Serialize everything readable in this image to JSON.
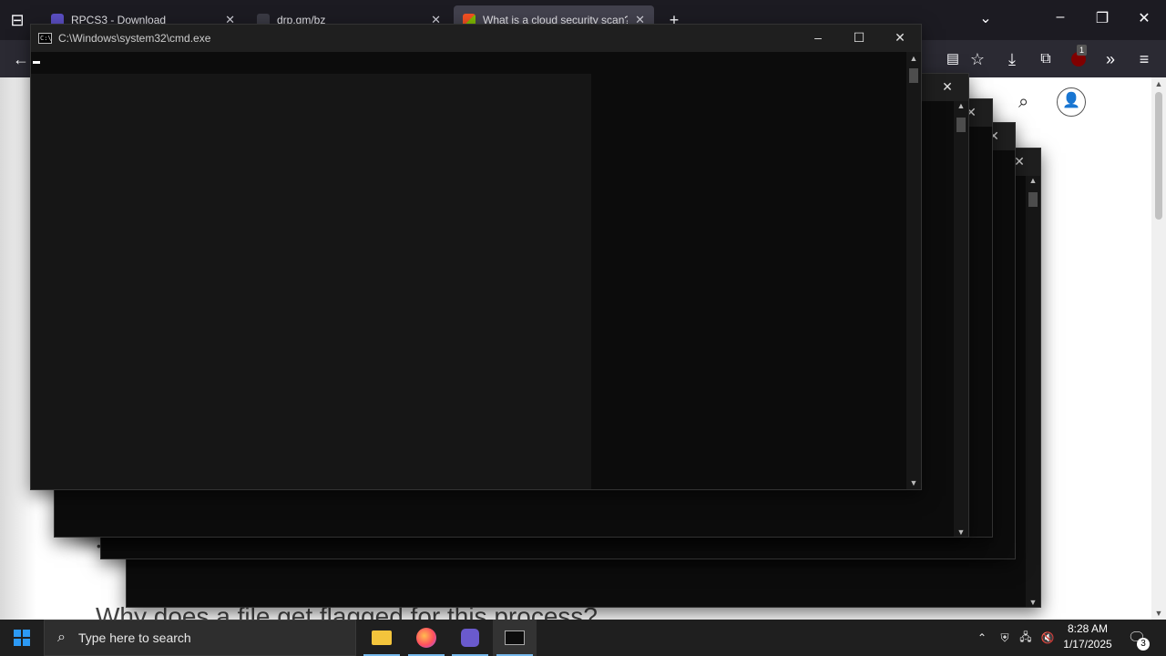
{
  "browser": {
    "tabs": [
      {
        "label": "RPCS3 - Download",
        "favicon_color": "#5b4fc4"
      },
      {
        "label": "drp.gm/bz",
        "favicon_color": "#3a3a44"
      },
      {
        "label": "What is a cloud security scan? -",
        "favicon_color": "#f25022",
        "active": true
      }
    ],
    "new_tab_icon": "plus-icon"
  },
  "page": {
    "heading": "Why does a file get flagged for this process?",
    "bullet": "•"
  },
  "cmd": {
    "title": "C:\\Windows\\system32\\cmd.exe",
    "icon_text": "C:\\"
  },
  "taskbar": {
    "search_placeholder": "Type here to search",
    "time": "8:28 AM",
    "date": "1/17/2025",
    "notification_count": "3",
    "extension_badge": "1"
  },
  "colors": {
    "accent": "#2c9af5",
    "console_bg": "#0c0c0c",
    "taskbar_bg": "#1f1f1f"
  }
}
